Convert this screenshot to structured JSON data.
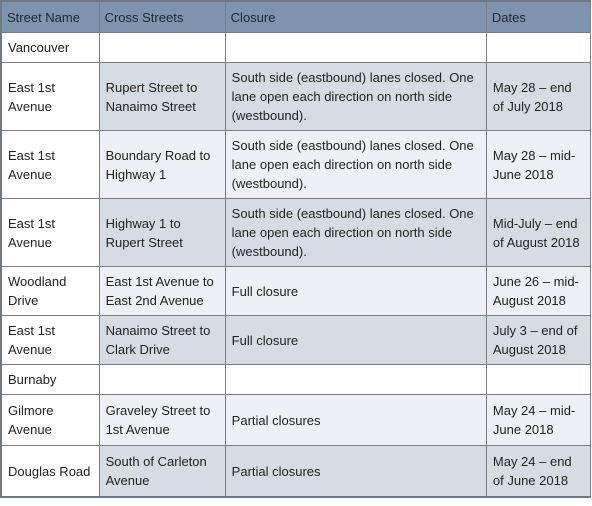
{
  "table": {
    "headers": [
      "Street Name",
      "Cross Streets",
      "Closure",
      "Dates"
    ],
    "rows": [
      {
        "type": "region",
        "street": "Vancouver",
        "cross": "",
        "closure": "",
        "dates": ""
      },
      {
        "type": "entry",
        "shade": "dark",
        "street": "East 1st Avenue",
        "cross": "Rupert Street to Nanaimo Street",
        "closure": "South side (eastbound) lanes closed. One lane open each direction on north side (westbound).",
        "dates": "May 28 – end of July 2018"
      },
      {
        "type": "entry",
        "shade": "light",
        "street": "East 1st Avenue",
        "cross": "Boundary Road to Highway 1",
        "closure": "South side (eastbound) lanes closed. One lane open each direction on north side (westbound).",
        "dates": "May 28 – mid-June 2018"
      },
      {
        "type": "entry",
        "shade": "dark",
        "street": "East 1st Avenue",
        "cross": "Highway 1 to Rupert Street",
        "closure": "South side (eastbound) lanes closed. One lane open each direction on north side (westbound).",
        "dates": "Mid-July – end of August 2018"
      },
      {
        "type": "entry",
        "shade": "light",
        "street": "Woodland Drive",
        "cross": "East 1st Avenue to East 2nd Avenue",
        "closure": "Full closure",
        "dates": "June 26 – mid-August 2018"
      },
      {
        "type": "entry",
        "shade": "dark",
        "street": "East 1st Avenue",
        "cross": "Nanaimo Street to Clark Drive",
        "closure": "Full closure",
        "dates": "July 3 – end of August 2018"
      },
      {
        "type": "region",
        "street": "Burnaby",
        "cross": "",
        "closure": "",
        "dates": ""
      },
      {
        "type": "entry",
        "shade": "light",
        "street": "Gilmore Avenue",
        "cross": "Graveley Street to 1st Avenue",
        "closure": "Partial closures",
        "dates": "May 24 – mid-June 2018"
      },
      {
        "type": "entry",
        "shade": "dark",
        "street": "Douglas Road",
        "cross": "South of Carleton Avenue",
        "closure": "Partial closures",
        "dates": "May 24 – end of June 2018"
      }
    ]
  }
}
